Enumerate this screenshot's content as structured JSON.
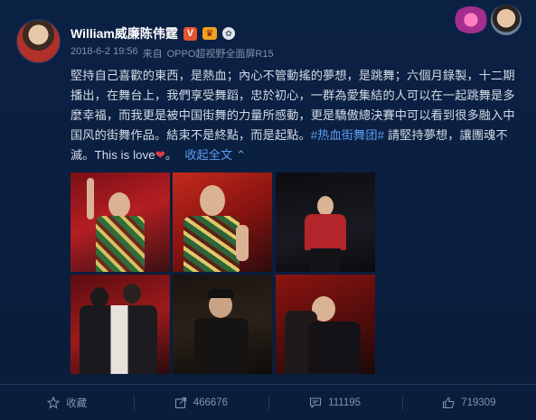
{
  "post": {
    "author": {
      "name": "William威廉陈伟霆",
      "verified_badge": "V"
    },
    "meta": {
      "datetime": "2018-6-2 19:56",
      "source_prefix": "来自",
      "source": "OPPO超视野全面屏R15"
    },
    "content": {
      "text_main": "堅持自己喜歡的東西，是熱血；內心不管動搖的夢想，是跳舞；六個月錄製，十二期播出，在舞台上，我們享受舞蹈，忠於初心，一群為愛集結的人可以在一起跳舞是多麼幸福，而我更是被中国街舞的力量所感動，更是驕傲總決賽中可以看到很多融入中国风的街舞作品。結束不是終點，而是起點。",
      "hashtag": "#热血街舞团#",
      "text_after_tag": " 請堅持夢想，讓團魂不滅。This is love",
      "heart": "❤",
      "collapse_label": "收起全文",
      "collapse_icon": "chevron-up-icon"
    },
    "photos": [
      {
        "id": "photo-1"
      },
      {
        "id": "photo-2"
      },
      {
        "id": "photo-3"
      },
      {
        "id": "photo-4"
      },
      {
        "id": "photo-5"
      },
      {
        "id": "photo-6"
      }
    ]
  },
  "actions": {
    "favorite": {
      "label": "收藏",
      "icon": "star-icon"
    },
    "repost": {
      "label": "466676",
      "icon": "share-icon"
    },
    "comment": {
      "label": "111195",
      "icon": "comment-icon"
    },
    "like": {
      "label": "719309",
      "icon": "thumbs-up-icon"
    }
  },
  "colors": {
    "background": "#0a1e3c",
    "link": "#5b9df5",
    "muted": "#8292aa",
    "verified": "#e6542e"
  }
}
